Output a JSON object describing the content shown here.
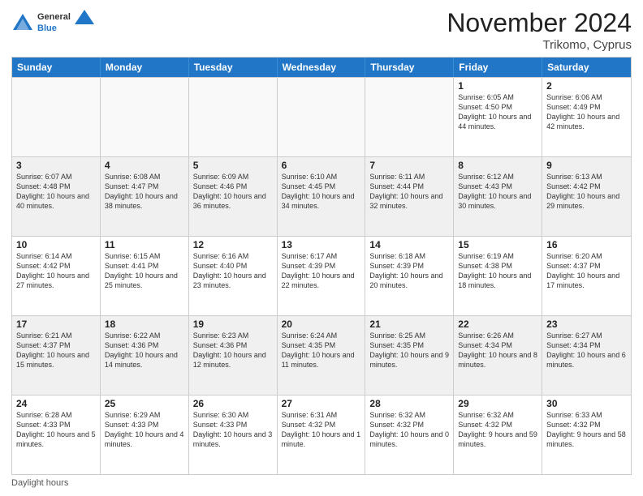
{
  "logo": {
    "general": "General",
    "blue": "Blue"
  },
  "title": "November 2024",
  "subtitle": "Trikomo, Cyprus",
  "days_of_week": [
    "Sunday",
    "Monday",
    "Tuesday",
    "Wednesday",
    "Thursday",
    "Friday",
    "Saturday"
  ],
  "footer": "Daylight hours",
  "weeks": [
    [
      {
        "day": "",
        "empty": true
      },
      {
        "day": "",
        "empty": true
      },
      {
        "day": "",
        "empty": true
      },
      {
        "day": "",
        "empty": true
      },
      {
        "day": "",
        "empty": true
      },
      {
        "day": "1",
        "sunrise": "6:05 AM",
        "sunset": "4:50 PM",
        "daylight": "10 hours and 44 minutes."
      },
      {
        "day": "2",
        "sunrise": "6:06 AM",
        "sunset": "4:49 PM",
        "daylight": "10 hours and 42 minutes."
      }
    ],
    [
      {
        "day": "3",
        "sunrise": "6:07 AM",
        "sunset": "4:48 PM",
        "daylight": "10 hours and 40 minutes."
      },
      {
        "day": "4",
        "sunrise": "6:08 AM",
        "sunset": "4:47 PM",
        "daylight": "10 hours and 38 minutes."
      },
      {
        "day": "5",
        "sunrise": "6:09 AM",
        "sunset": "4:46 PM",
        "daylight": "10 hours and 36 minutes."
      },
      {
        "day": "6",
        "sunrise": "6:10 AM",
        "sunset": "4:45 PM",
        "daylight": "10 hours and 34 minutes."
      },
      {
        "day": "7",
        "sunrise": "6:11 AM",
        "sunset": "4:44 PM",
        "daylight": "10 hours and 32 minutes."
      },
      {
        "day": "8",
        "sunrise": "6:12 AM",
        "sunset": "4:43 PM",
        "daylight": "10 hours and 30 minutes."
      },
      {
        "day": "9",
        "sunrise": "6:13 AM",
        "sunset": "4:42 PM",
        "daylight": "10 hours and 29 minutes."
      }
    ],
    [
      {
        "day": "10",
        "sunrise": "6:14 AM",
        "sunset": "4:42 PM",
        "daylight": "10 hours and 27 minutes."
      },
      {
        "day": "11",
        "sunrise": "6:15 AM",
        "sunset": "4:41 PM",
        "daylight": "10 hours and 25 minutes."
      },
      {
        "day": "12",
        "sunrise": "6:16 AM",
        "sunset": "4:40 PM",
        "daylight": "10 hours and 23 minutes."
      },
      {
        "day": "13",
        "sunrise": "6:17 AM",
        "sunset": "4:39 PM",
        "daylight": "10 hours and 22 minutes."
      },
      {
        "day": "14",
        "sunrise": "6:18 AM",
        "sunset": "4:39 PM",
        "daylight": "10 hours and 20 minutes."
      },
      {
        "day": "15",
        "sunrise": "6:19 AM",
        "sunset": "4:38 PM",
        "daylight": "10 hours and 18 minutes."
      },
      {
        "day": "16",
        "sunrise": "6:20 AM",
        "sunset": "4:37 PM",
        "daylight": "10 hours and 17 minutes."
      }
    ],
    [
      {
        "day": "17",
        "sunrise": "6:21 AM",
        "sunset": "4:37 PM",
        "daylight": "10 hours and 15 minutes."
      },
      {
        "day": "18",
        "sunrise": "6:22 AM",
        "sunset": "4:36 PM",
        "daylight": "10 hours and 14 minutes."
      },
      {
        "day": "19",
        "sunrise": "6:23 AM",
        "sunset": "4:36 PM",
        "daylight": "10 hours and 12 minutes."
      },
      {
        "day": "20",
        "sunrise": "6:24 AM",
        "sunset": "4:35 PM",
        "daylight": "10 hours and 11 minutes."
      },
      {
        "day": "21",
        "sunrise": "6:25 AM",
        "sunset": "4:35 PM",
        "daylight": "10 hours and 9 minutes."
      },
      {
        "day": "22",
        "sunrise": "6:26 AM",
        "sunset": "4:34 PM",
        "daylight": "10 hours and 8 minutes."
      },
      {
        "day": "23",
        "sunrise": "6:27 AM",
        "sunset": "4:34 PM",
        "daylight": "10 hours and 6 minutes."
      }
    ],
    [
      {
        "day": "24",
        "sunrise": "6:28 AM",
        "sunset": "4:33 PM",
        "daylight": "10 hours and 5 minutes."
      },
      {
        "day": "25",
        "sunrise": "6:29 AM",
        "sunset": "4:33 PM",
        "daylight": "10 hours and 4 minutes."
      },
      {
        "day": "26",
        "sunrise": "6:30 AM",
        "sunset": "4:33 PM",
        "daylight": "10 hours and 3 minutes."
      },
      {
        "day": "27",
        "sunrise": "6:31 AM",
        "sunset": "4:32 PM",
        "daylight": "10 hours and 1 minute."
      },
      {
        "day": "28",
        "sunrise": "6:32 AM",
        "sunset": "4:32 PM",
        "daylight": "10 hours and 0 minutes."
      },
      {
        "day": "29",
        "sunrise": "6:32 AM",
        "sunset": "4:32 PM",
        "daylight": "9 hours and 59 minutes."
      },
      {
        "day": "30",
        "sunrise": "6:33 AM",
        "sunset": "4:32 PM",
        "daylight": "9 hours and 58 minutes."
      }
    ]
  ]
}
